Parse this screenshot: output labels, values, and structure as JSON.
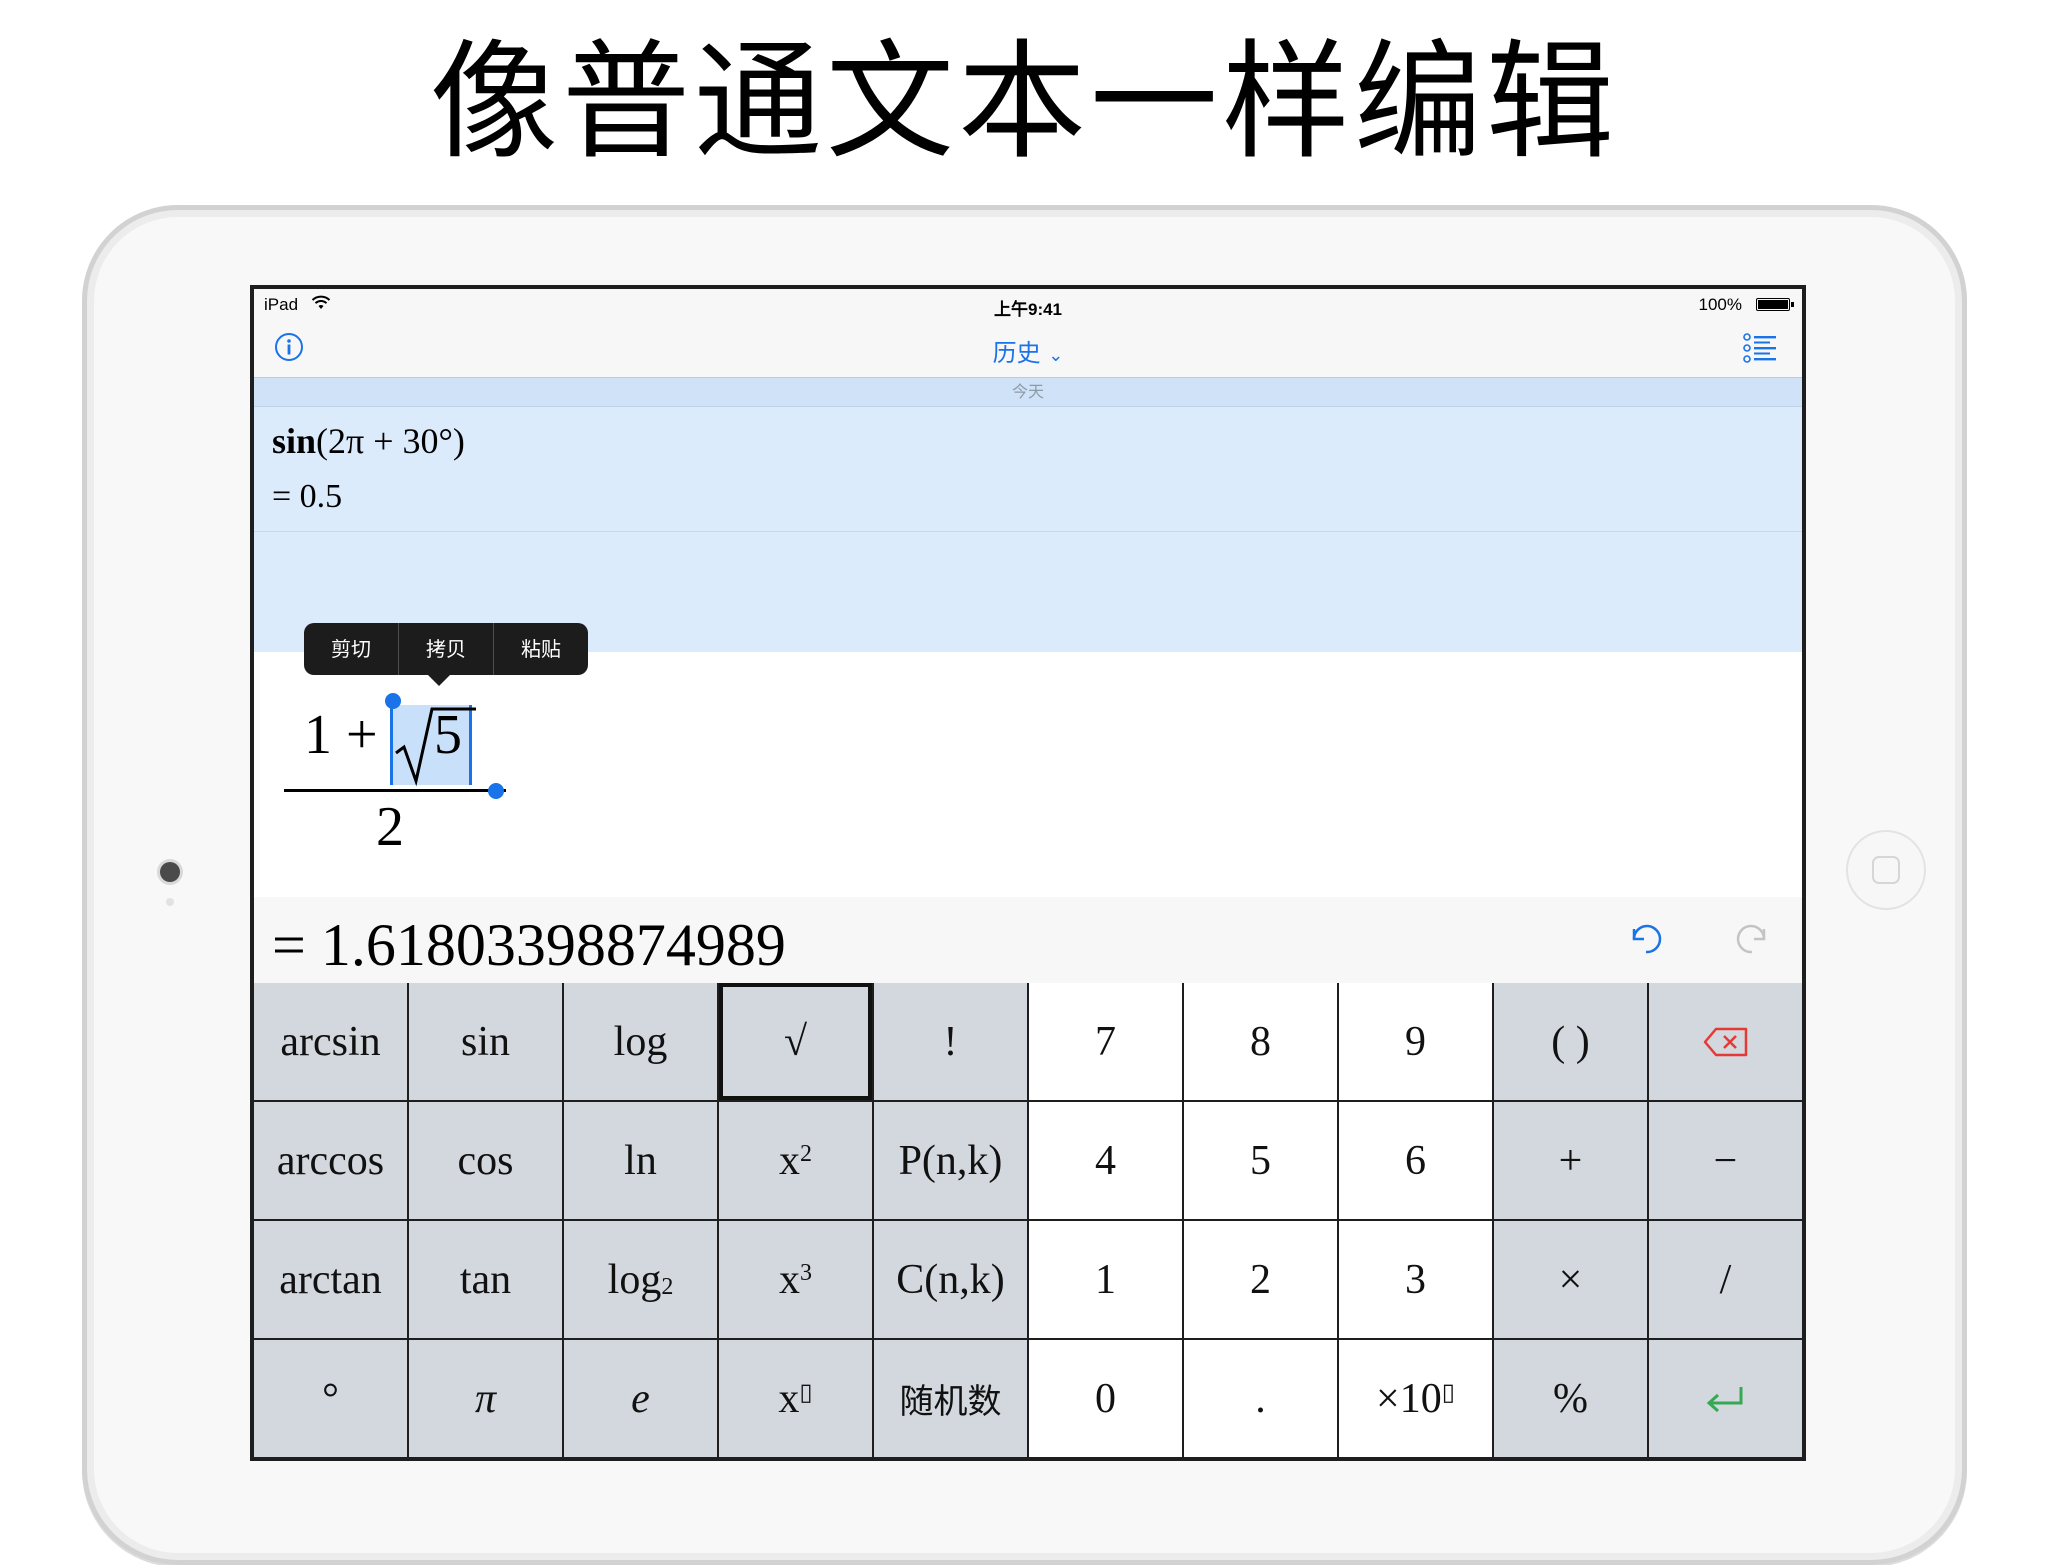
{
  "headline": "像普通文本一样编辑",
  "status_bar": {
    "carrier": "iPad",
    "time": "上午9:41",
    "battery": "100%"
  },
  "nav": {
    "title": "历史",
    "title_chevron": "⌄",
    "left_icon": "info-icon",
    "right_icon": "list-icon"
  },
  "history": {
    "date_header": "今天",
    "entries": [
      {
        "fn": "sin",
        "args": "(2π + 30°)",
        "result": "= 0.5"
      }
    ]
  },
  "context_menu": {
    "items": [
      "剪切",
      "拷贝",
      "粘贴"
    ]
  },
  "editor": {
    "numerator_one": "1",
    "numerator_plus": "+",
    "radicand": "5",
    "denominator": "2"
  },
  "result": {
    "value": "= 1.61803398874989",
    "undo_icon": "undo-icon",
    "redo_icon": "redo-icon"
  },
  "keypad": {
    "row1": {
      "arcsin": "arcsin",
      "sin": "sin",
      "log": "log",
      "sqrt": "√",
      "factorial": "!",
      "seven": "7",
      "eight": "8",
      "nine": "9",
      "parens": "( )",
      "delete_icon": "backspace-icon"
    },
    "row2": {
      "arccos": "arccos",
      "cos": "cos",
      "ln": "ln",
      "square_base": "x",
      "square_exp": "2",
      "permutation": "P(n,k)",
      "four": "4",
      "five": "5",
      "six": "6",
      "plus": "+",
      "minus": "−"
    },
    "row3": {
      "arctan": "arctan",
      "tan": "tan",
      "log2_base": "log",
      "log2_sub": "2",
      "cube_base": "x",
      "cube_exp": "3",
      "combination": "C(n,k)",
      "one": "1",
      "two": "2",
      "three": "3",
      "times": "×",
      "divide": "/"
    },
    "row4": {
      "degree": "°",
      "pi": "π",
      "e": "e",
      "power_base": "x",
      "power_exp": "▯",
      "random": "随机数",
      "zero": "0",
      "dot": ".",
      "sci_base": "×10",
      "sci_exp": "▯",
      "percent": "%",
      "enter_icon": "return-icon"
    }
  },
  "colors": {
    "accent": "#1a73e8",
    "history_bg": "#dbebfc",
    "function_key": "#d3d8de",
    "number_key": "#ffffff",
    "delete_icon": "#e53935",
    "enter_icon": "#34a853"
  }
}
